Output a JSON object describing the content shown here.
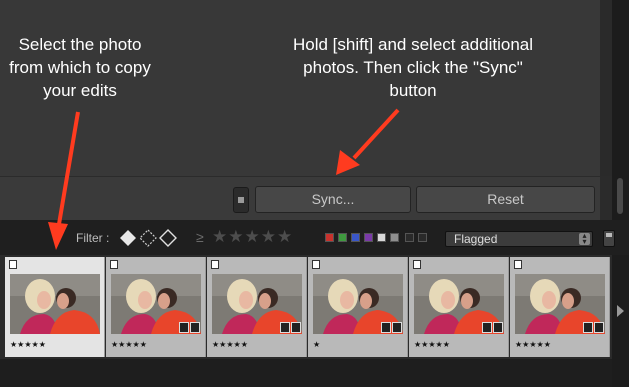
{
  "annotations": {
    "left": "Select the photo from which to copy your edits",
    "right": "Hold [shift] and select additional photos. Then click the \"Sync\" button"
  },
  "buttons": {
    "sync": "Sync...",
    "reset": "Reset"
  },
  "filter_bar": {
    "label": "Filter :",
    "rating_operator": "≥",
    "stars": "★★★★★",
    "dropdown_value": "Flagged",
    "color_labels": [
      "#c8322d",
      "#3f9a3f",
      "#3a56c8",
      "#7a3aa8",
      "#d8d8d8",
      "#8f8f8f"
    ]
  },
  "filmstrip": [
    {
      "rating": "★★★★★",
      "selected": true
    },
    {
      "rating": "★★★★★",
      "selected": false
    },
    {
      "rating": "★★★★★",
      "selected": false
    },
    {
      "rating": "★",
      "selected": false
    },
    {
      "rating": "★★★★★",
      "selected": false
    },
    {
      "rating": "★★★★★",
      "selected": false
    }
  ],
  "colors": {
    "arrow": "#ff3b1f",
    "panel": "#383838",
    "button": "#474747"
  }
}
